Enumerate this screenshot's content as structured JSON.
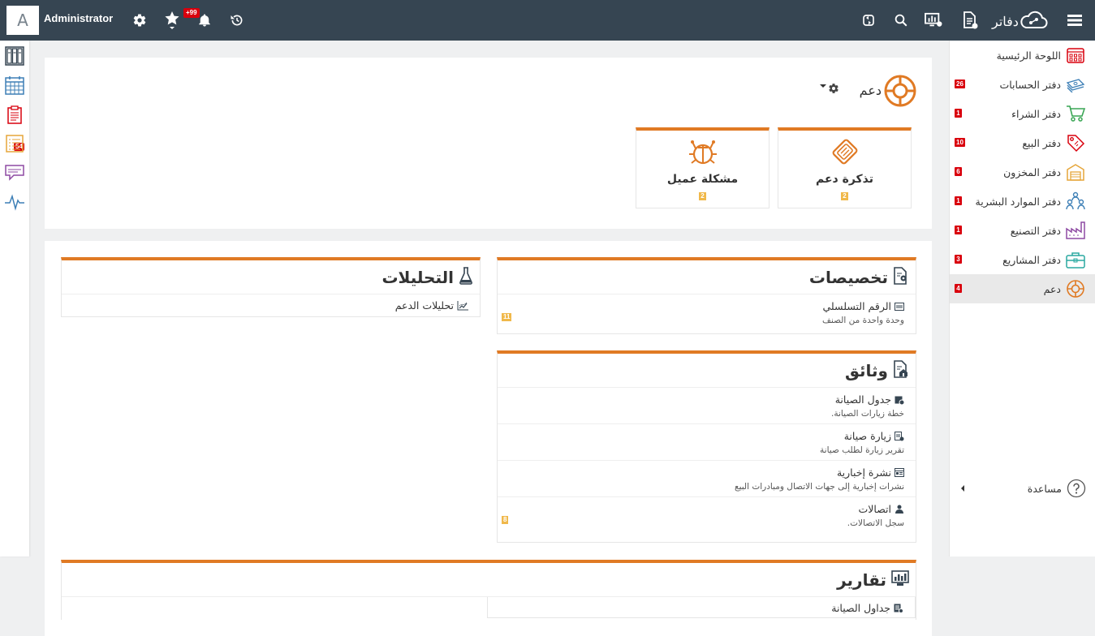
{
  "topbar": {
    "avatar_letter": "A",
    "username": "Administrator",
    "notifications_badge": "+99",
    "logo_text": "دفاتر"
  },
  "left_rail": {
    "icons": [
      "binders-icon",
      "calendar-icon",
      "clipboard-icon",
      "list-icon",
      "chat-icon",
      "pulse-icon"
    ],
    "clipboard_badge": "54"
  },
  "sidebar": {
    "items": [
      {
        "label": "اللوحة الرئيسية",
        "badge": "",
        "icon": "dashboard-icon",
        "color": "#d9000d"
      },
      {
        "label": "دفتر الحسابات",
        "badge": "26",
        "icon": "money-icon",
        "color": "#3d7fb6"
      },
      {
        "label": "دفتر الشراء",
        "badge": "1",
        "icon": "cart-icon",
        "color": "#3aa655"
      },
      {
        "label": "دفتر البيع",
        "badge": "10",
        "icon": "tag-icon",
        "color": "#d9000d"
      },
      {
        "label": "دفتر المخزون",
        "badge": "6",
        "icon": "warehouse-icon",
        "color": "#e6a63a"
      },
      {
        "label": "دفتر الموارد البشرية",
        "badge": "1",
        "icon": "people-icon",
        "color": "#3d7fb6"
      },
      {
        "label": "دفتر التصنيع",
        "badge": "1",
        "icon": "factory-icon",
        "color": "#8e4aa3"
      },
      {
        "label": "دفتر المشاريع",
        "badge": "3",
        "icon": "briefcase-icon",
        "color": "#2aa9a0"
      },
      {
        "label": "دعم",
        "badge": "4",
        "icon": "lifebuoy-icon",
        "color": "#e07a24"
      }
    ],
    "help_label": "مساعدة"
  },
  "header": {
    "title": "دعم",
    "cards": [
      {
        "title": "تذكرة دعم",
        "count": "2"
      },
      {
        "title": "مشكلة عميل",
        "count": "2"
      }
    ]
  },
  "sections": {
    "specs": {
      "title": "تخصيصات",
      "entries": [
        {
          "title": "الرقم التسلسلي",
          "desc": "وحدة واحدة من الصنف",
          "count": "11"
        }
      ]
    },
    "analytics": {
      "title": "التحليلات",
      "entries": [
        {
          "title": "تحليلات الدعم"
        }
      ]
    },
    "documents": {
      "title": "وثائق",
      "entries": [
        {
          "title": "جدول الصيانة",
          "desc": "خطة زيارات الصيانة."
        },
        {
          "title": "زيارة صيانة",
          "desc": "تقرير زيارة لطلب صيانة"
        },
        {
          "title": "نشرة إخبارية",
          "desc": "نشرات إخبارية إلى جهات الاتصال ومبادرات البيع"
        },
        {
          "title": "اتصالات",
          "desc": "سجل الاتصالات.",
          "count": "8"
        }
      ]
    },
    "reports": {
      "title": "تقارير",
      "entries": [
        {
          "title": "جداول الصيانة"
        }
      ]
    }
  },
  "colors": {
    "topbar": "#364552",
    "accent": "#e07a24",
    "badge_red": "#d9000d",
    "badge_yellow": "#f0b84a"
  }
}
